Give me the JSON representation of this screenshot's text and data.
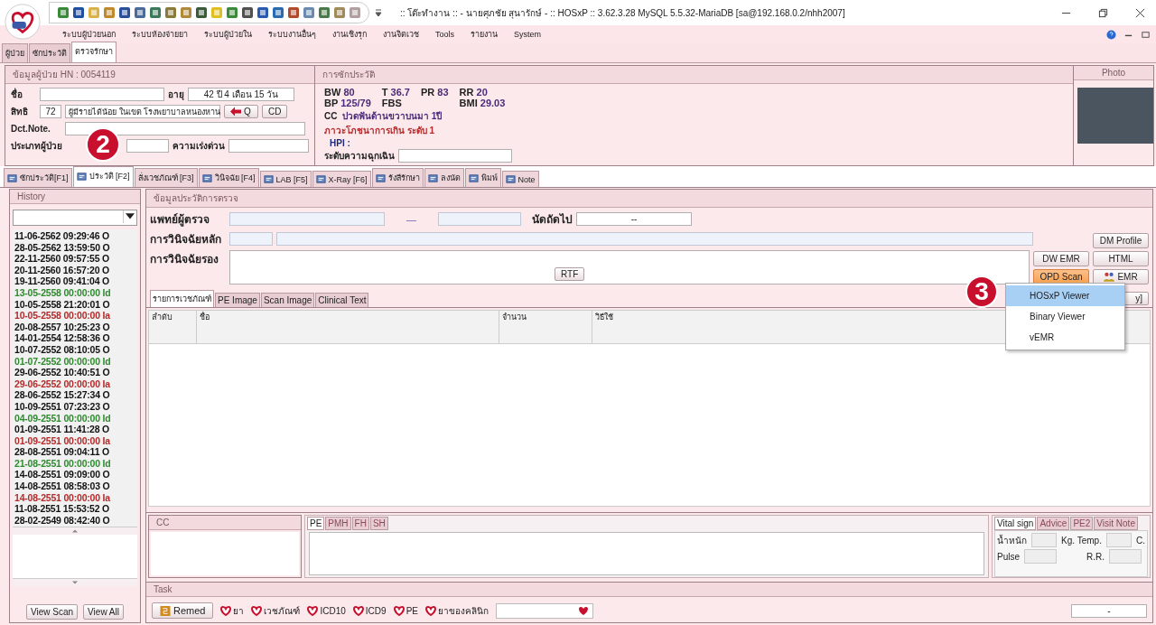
{
  "window": {
    "title": ":: โต๊ะทำงาน :: - นายศุภชัย สุนารักษ์ - :: HOSxP :: 3.62.3.28 MySQL 5.5.32-MariaDB [sa@192.168.0.2/nhh2007]"
  },
  "menu": [
    "ระบบผู้ป่วยนอก",
    "ระบบห้องจ่ายยา",
    "ระบบผู้ป่วยใน",
    "ระบบงานอื่นๆ",
    "งานเชิงรุก",
    "งานจิตเวช",
    "Tools",
    "รายงาน",
    "System"
  ],
  "module_tabs": [
    {
      "label": "ผู้ป่วย",
      "selected": false
    },
    {
      "label": "ซักประวัติ",
      "selected": false
    },
    {
      "label": "ตรวจรักษา",
      "selected": true
    }
  ],
  "patient": {
    "title": "ข้อมูลผู้ป่วย HN : 0054119",
    "name_label": "ชื่อ",
    "age_label": "อายุ",
    "age": "42 ปี 4 เดือน 15 วัน",
    "right_label": "สิทธิ",
    "right_code": "72",
    "right_name": "ผู้มีรายได้น้อย ในเขต โรงพยาบาลหนองหาน",
    "q_button": "Q",
    "cd_button": "CD",
    "note_label": "Dct.Note.",
    "type_label": "ประเภทผู้ป่วย",
    "urgency_label": "ความเร่งด่วน"
  },
  "screening": {
    "title": "การซักประวัติ",
    "vitals": [
      {
        "label": "BW",
        "value": "80"
      },
      {
        "label": "T",
        "value": "36.7"
      },
      {
        "label": "PR",
        "value": "83"
      },
      {
        "label": "RR",
        "value": "20"
      },
      {
        "label": "BP",
        "value": "125/79"
      },
      {
        "label": "FBS"
      },
      {
        "label": "BMI",
        "value": "29.03"
      }
    ],
    "cc_label": "CC",
    "cc": "ปวดฟันด้านขวาบนมา 1ปี",
    "nutrition": "ภาวะโภชนาการเกิน ระดับ 1",
    "hpi_label": "HPI :",
    "emergency_label": "ระดับความฉุกเฉิน"
  },
  "photo": {
    "title": "Photo"
  },
  "callouts": [
    "2",
    "3"
  ],
  "visit_tabs": [
    {
      "label": "ซักประวัติ[F1]",
      "selected": false,
      "has_icon": true
    },
    {
      "label": "ประวัติ [F2]",
      "selected": true,
      "has_icon": true
    },
    {
      "label": "สั่งเวชภัณฑ์ [F3]",
      "selected": false,
      "has_icon": false
    },
    {
      "label": "วินิจฉัย [F4]",
      "selected": false,
      "has_icon": true
    },
    {
      "label": "LAB [F5]",
      "selected": false,
      "has_icon": true
    },
    {
      "label": "X-Ray [F6]",
      "selected": false,
      "has_icon": true
    },
    {
      "label": "รังสีรักษา",
      "selected": false,
      "has_icon": true
    },
    {
      "label": "ลงนัด",
      "selected": false,
      "has_icon": true
    },
    {
      "label": "พิมพ์",
      "selected": false,
      "has_icon": true
    },
    {
      "label": "Note",
      "selected": false,
      "has_icon": true
    }
  ],
  "history": {
    "title": "History",
    "entries": [
      {
        "text": "11-06-2562 09:29:46 O",
        "color": "#111111"
      },
      {
        "text": "28-05-2562 13:59:50 O",
        "color": "#111111"
      },
      {
        "text": "22-11-2560 09:57:55 O",
        "color": "#111111"
      },
      {
        "text": "20-11-2560 16:57:20 O",
        "color": "#111111"
      },
      {
        "text": "19-11-2560 09:41:04 O",
        "color": "#111111"
      },
      {
        "text": "13-05-2558 00:00:00 Id",
        "color": "#2e8b2e"
      },
      {
        "text": "10-05-2558 21:20:01 O",
        "color": "#111111"
      },
      {
        "text": "10-05-2558 00:00:00 Ia",
        "color": "#b52a2a"
      },
      {
        "text": "20-08-2557 10:25:23 O",
        "color": "#111111"
      },
      {
        "text": "14-01-2554 12:58:36 O",
        "color": "#111111"
      },
      {
        "text": "10-07-2552 08:10:05 O",
        "color": "#111111"
      },
      {
        "text": "01-07-2552 00:00:00 Id",
        "color": "#2e8b2e"
      },
      {
        "text": "29-06-2552 10:40:51 O",
        "color": "#111111"
      },
      {
        "text": "29-06-2552 00:00:00 Ia",
        "color": "#b52a2a"
      },
      {
        "text": "28-06-2552 15:27:34 O",
        "color": "#111111"
      },
      {
        "text": "10-09-2551 07:23:23 O",
        "color": "#111111"
      },
      {
        "text": "04-09-2551 00:00:00 Id",
        "color": "#2e8b2e"
      },
      {
        "text": "01-09-2551 11:41:28 O",
        "color": "#111111"
      },
      {
        "text": "01-09-2551 00:00:00 Ia",
        "color": "#b52a2a"
      },
      {
        "text": "28-08-2551 09:04:11 O",
        "color": "#111111"
      },
      {
        "text": "21-08-2551 00:00:00 Id",
        "color": "#2e8b2e"
      },
      {
        "text": "14-08-2551 09:09:00 O",
        "color": "#111111"
      },
      {
        "text": "14-08-2551 08:58:03 O",
        "color": "#111111"
      },
      {
        "text": "14-08-2551 00:00:00 Ia",
        "color": "#b52a2a"
      },
      {
        "text": "11-08-2551 15:53:52 O",
        "color": "#111111"
      },
      {
        "text": "28-02-2549 08:42:40 O",
        "color": "#111111"
      }
    ],
    "buttons": [
      "View Scan",
      "View All"
    ]
  },
  "exam": {
    "title": "ข้อมูลประวัติการตรวจ",
    "doctor_label": "แพทย์ผู้ตรวจ",
    "dash": "—",
    "appointment_label": "นัดถัดไป",
    "appointment": "--",
    "main_dx_label": "การวินิจฉัยหลัก",
    "secondary_dx_label": "การวินิจฉัยรอง",
    "rtf_button": "RTF",
    "dm_profile_button": "DM Profile",
    "dw_emr_button": "DW EMR",
    "html_button": "HTML",
    "opd_scan_button": "OPD Scan",
    "emr_button": "EMR"
  },
  "opd_scan_menu": [
    {
      "label": "HOSxP Viewer",
      "selected": true
    },
    {
      "label": "Binary Viewer",
      "selected": false
    },
    {
      "label": "vEMR",
      "selected": false
    }
  ],
  "order_tabs": [
    {
      "label": "รายการเวชภัณฑ์",
      "selected": true
    },
    {
      "label": "PE Image",
      "selected": false
    },
    {
      "label": "Scan Image",
      "selected": false
    },
    {
      "label": "Clinical Text",
      "selected": false
    }
  ],
  "covered_button_text": "y]",
  "table": {
    "columns": [
      "ลำดับ",
      "ชื่อ",
      "จำนวน",
      "วิธีใช้"
    ]
  },
  "cc_panel": {
    "title": "CC"
  },
  "pe_tabs": [
    {
      "label": "PE",
      "selected": true
    },
    {
      "label": "PMH",
      "selected": false
    },
    {
      "label": "FH",
      "selected": false
    },
    {
      "label": "SH",
      "selected": false
    }
  ],
  "vital_tabs": [
    {
      "label": "Vital sign",
      "selected": true
    },
    {
      "label": "Advice",
      "selected": false
    },
    {
      "label": "PE2",
      "selected": false
    },
    {
      "label": "Visit Note",
      "selected": false
    }
  ],
  "vital_fields": {
    "weight_label": "น้ำหนัก",
    "kg_label": "Kg.",
    "temp_label": "Temp.",
    "c_label": "C.",
    "pulse_label": "Pulse",
    "rr_label": "R.R."
  },
  "task": {
    "title": "Task",
    "remed_button": "Remed",
    "items": [
      "ยา",
      "เวชภัณฑ์",
      "ICD10",
      "ICD9",
      "PE",
      "ยาของคลินิก"
    ],
    "right_value": "-"
  }
}
